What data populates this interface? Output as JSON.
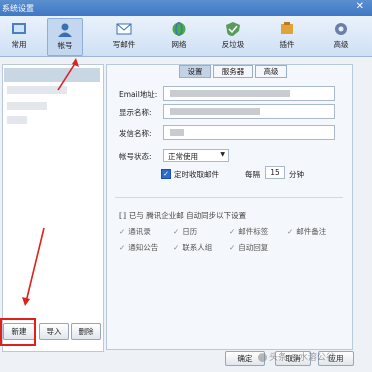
{
  "window": {
    "title": "系统设置",
    "close_glyph": "✕"
  },
  "toolbar": {
    "items": [
      {
        "label": "常用",
        "icon": "gear-icon"
      },
      {
        "label": "帐号",
        "icon": "account-person-icon",
        "selected": true
      },
      {
        "label": "写邮件",
        "icon": "compose-icon"
      },
      {
        "label": "网络",
        "icon": "globe-network-icon"
      },
      {
        "label": "反垃圾",
        "icon": "shield-antispam-icon"
      },
      {
        "label": "插件",
        "icon": "plugin-icon"
      },
      {
        "label": "高级",
        "icon": "advanced-icon"
      }
    ]
  },
  "left_panel": {
    "buttons": {
      "new": "新建",
      "import": "导入",
      "delete": "删除"
    }
  },
  "right_panel": {
    "tabs": [
      "设置",
      "服务器",
      "高级"
    ],
    "fields": {
      "email_label": "Email地址:",
      "display_label": "显示名称:",
      "sender_label": "发信名称:",
      "status_label": "帐号状态:"
    },
    "status_value": "正常使用",
    "auto_receive": {
      "label": "定时收取邮件",
      "every": "每隔",
      "minutes": "15",
      "unit": "分钟",
      "checked": true
    },
    "sync": {
      "title": "已与 腾讯企业邮 自动同步以下设置",
      "items": [
        "通讯录",
        "日历",
        "邮件标签",
        "邮件备注",
        "通知公告",
        "联系人组",
        "自动回复"
      ]
    }
  },
  "footer": {
    "ok": "确定",
    "cancel": "取消",
    "apply": "应用"
  },
  "watermark": "头条 @水溶公谷",
  "colors": {
    "accent": "#3f78c3",
    "annotation": "#e0201a"
  }
}
